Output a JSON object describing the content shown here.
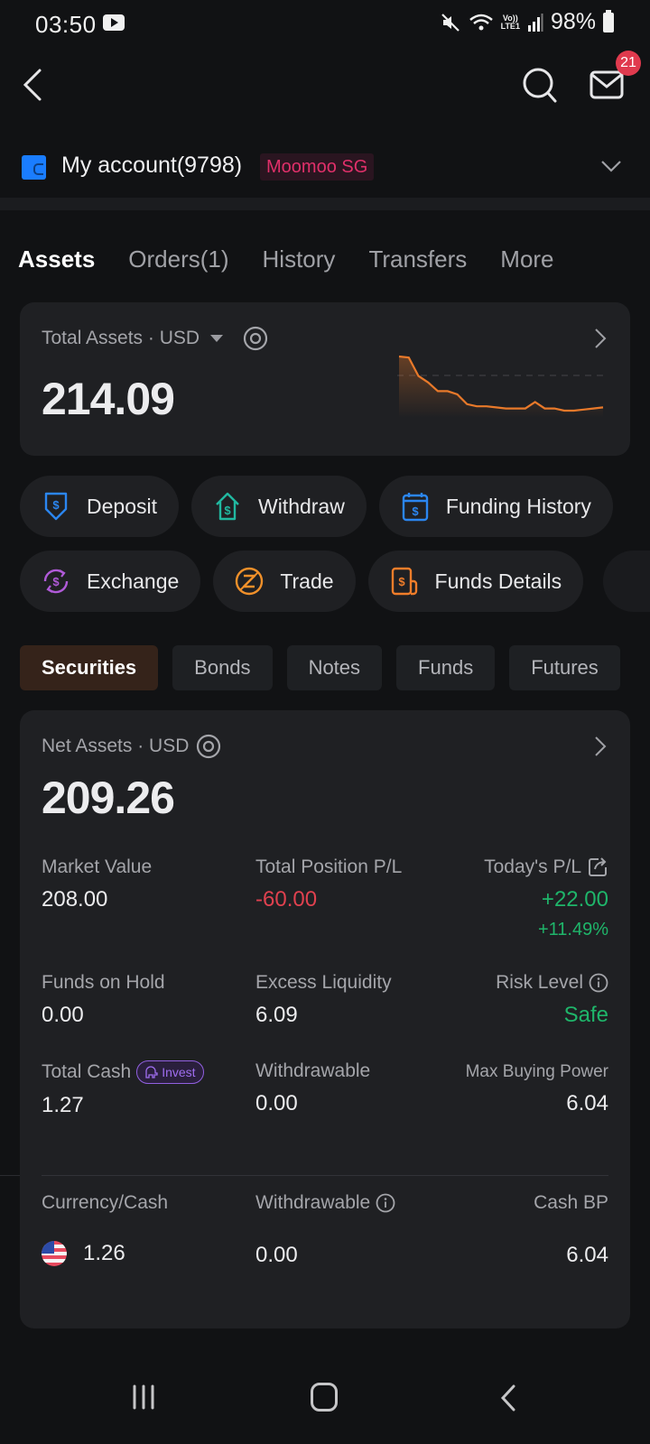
{
  "status_bar": {
    "time": "03:50",
    "battery": "98%",
    "network": "LTE1",
    "volte": "Vo))"
  },
  "top_nav": {
    "mail_badge_count": "21"
  },
  "account": {
    "name": "My account(9798)",
    "broker_badge": "Moomoo SG"
  },
  "main_tabs": [
    {
      "label": "Assets",
      "active": true
    },
    {
      "label": "Orders(1)",
      "active": false
    },
    {
      "label": "History",
      "active": false
    },
    {
      "label": "Transfers",
      "active": false
    },
    {
      "label": "More",
      "active": false
    }
  ],
  "total_assets": {
    "label": "Total Assets · USD",
    "value": "214.09",
    "sparkline": {
      "color": "#e8792a",
      "values": [
        100,
        99,
        82,
        76,
        68,
        68,
        65,
        56,
        54,
        54,
        53,
        52,
        52,
        52,
        58,
        52,
        52,
        50,
        50,
        51,
        52,
        53
      ]
    }
  },
  "actions": {
    "row1": [
      {
        "label": "Deposit",
        "icon": "deposit-icon",
        "color": "#2b86f0"
      },
      {
        "label": "Withdraw",
        "icon": "withdraw-icon",
        "color": "#21b8a0"
      },
      {
        "label": "Funding History",
        "icon": "funding-history-icon",
        "color": "#2b86f0"
      }
    ],
    "row2": [
      {
        "label": "Exchange",
        "icon": "exchange-icon",
        "color": "#b05ad8"
      },
      {
        "label": "Trade",
        "icon": "trade-icon",
        "color": "#f0902a"
      },
      {
        "label": "Funds Details",
        "icon": "funds-details-icon",
        "color": "#f07d2a"
      }
    ]
  },
  "asset_tabs": [
    {
      "label": "Securities",
      "active": true
    },
    {
      "label": "Bonds",
      "active": false
    },
    {
      "label": "Notes",
      "active": false
    },
    {
      "label": "Funds",
      "active": false
    },
    {
      "label": "Futures",
      "active": false
    }
  ],
  "net_assets": {
    "label": "Net Assets · USD",
    "value": "209.26",
    "market_value": {
      "label": "Market Value",
      "value": "208.00"
    },
    "total_position_pl": {
      "label": "Total Position P/L",
      "value": "-60.00"
    },
    "todays_pl": {
      "label": "Today's P/L",
      "value": "+22.00",
      "percent": "+11.49%"
    },
    "funds_on_hold": {
      "label": "Funds on Hold",
      "value": "0.00"
    },
    "excess_liquidity": {
      "label": "Excess Liquidity",
      "value": "6.09"
    },
    "risk_level": {
      "label": "Risk Level",
      "value": "Safe"
    },
    "total_cash": {
      "label": "Total Cash",
      "value": "1.27",
      "badge": "Invest"
    },
    "withdrawable": {
      "label": "Withdrawable",
      "value": "0.00"
    },
    "max_buying_power": {
      "label": "Max Buying Power",
      "value": "6.04"
    }
  },
  "currency_table": {
    "headers": [
      "Currency/Cash",
      "Withdrawable",
      "Cash BP"
    ],
    "rows": [
      {
        "currency": "USD",
        "cash": "1.26",
        "withdrawable": "0.00",
        "cash_bp": "6.04"
      }
    ]
  },
  "colors": {
    "accent": "#e86a18",
    "positive": "#1fb56a",
    "negative": "#e0414f",
    "background": "#111214",
    "card": "#1f2023"
  }
}
